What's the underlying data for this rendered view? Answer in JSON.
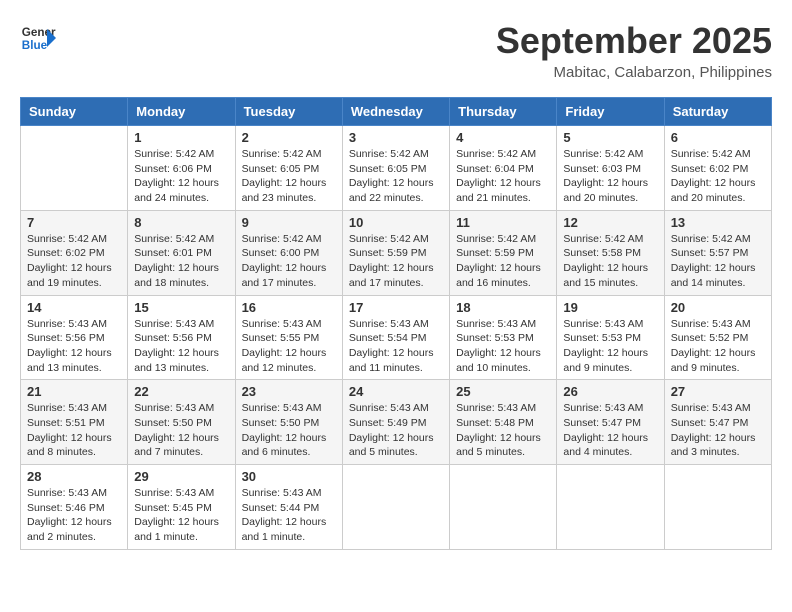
{
  "header": {
    "logo_line1": "General",
    "logo_line2": "Blue",
    "month": "September 2025",
    "location": "Mabitac, Calabarzon, Philippines"
  },
  "days_of_week": [
    "Sunday",
    "Monday",
    "Tuesday",
    "Wednesday",
    "Thursday",
    "Friday",
    "Saturday"
  ],
  "weeks": [
    [
      {
        "day": "",
        "info": ""
      },
      {
        "day": "1",
        "info": "Sunrise: 5:42 AM\nSunset: 6:06 PM\nDaylight: 12 hours\nand 24 minutes."
      },
      {
        "day": "2",
        "info": "Sunrise: 5:42 AM\nSunset: 6:05 PM\nDaylight: 12 hours\nand 23 minutes."
      },
      {
        "day": "3",
        "info": "Sunrise: 5:42 AM\nSunset: 6:05 PM\nDaylight: 12 hours\nand 22 minutes."
      },
      {
        "day": "4",
        "info": "Sunrise: 5:42 AM\nSunset: 6:04 PM\nDaylight: 12 hours\nand 21 minutes."
      },
      {
        "day": "5",
        "info": "Sunrise: 5:42 AM\nSunset: 6:03 PM\nDaylight: 12 hours\nand 20 minutes."
      },
      {
        "day": "6",
        "info": "Sunrise: 5:42 AM\nSunset: 6:02 PM\nDaylight: 12 hours\nand 20 minutes."
      }
    ],
    [
      {
        "day": "7",
        "info": "Sunrise: 5:42 AM\nSunset: 6:02 PM\nDaylight: 12 hours\nand 19 minutes."
      },
      {
        "day": "8",
        "info": "Sunrise: 5:42 AM\nSunset: 6:01 PM\nDaylight: 12 hours\nand 18 minutes."
      },
      {
        "day": "9",
        "info": "Sunrise: 5:42 AM\nSunset: 6:00 PM\nDaylight: 12 hours\nand 17 minutes."
      },
      {
        "day": "10",
        "info": "Sunrise: 5:42 AM\nSunset: 5:59 PM\nDaylight: 12 hours\nand 17 minutes."
      },
      {
        "day": "11",
        "info": "Sunrise: 5:42 AM\nSunset: 5:59 PM\nDaylight: 12 hours\nand 16 minutes."
      },
      {
        "day": "12",
        "info": "Sunrise: 5:42 AM\nSunset: 5:58 PM\nDaylight: 12 hours\nand 15 minutes."
      },
      {
        "day": "13",
        "info": "Sunrise: 5:42 AM\nSunset: 5:57 PM\nDaylight: 12 hours\nand 14 minutes."
      }
    ],
    [
      {
        "day": "14",
        "info": "Sunrise: 5:43 AM\nSunset: 5:56 PM\nDaylight: 12 hours\nand 13 minutes."
      },
      {
        "day": "15",
        "info": "Sunrise: 5:43 AM\nSunset: 5:56 PM\nDaylight: 12 hours\nand 13 minutes."
      },
      {
        "day": "16",
        "info": "Sunrise: 5:43 AM\nSunset: 5:55 PM\nDaylight: 12 hours\nand 12 minutes."
      },
      {
        "day": "17",
        "info": "Sunrise: 5:43 AM\nSunset: 5:54 PM\nDaylight: 12 hours\nand 11 minutes."
      },
      {
        "day": "18",
        "info": "Sunrise: 5:43 AM\nSunset: 5:53 PM\nDaylight: 12 hours\nand 10 minutes."
      },
      {
        "day": "19",
        "info": "Sunrise: 5:43 AM\nSunset: 5:53 PM\nDaylight: 12 hours\nand 9 minutes."
      },
      {
        "day": "20",
        "info": "Sunrise: 5:43 AM\nSunset: 5:52 PM\nDaylight: 12 hours\nand 9 minutes."
      }
    ],
    [
      {
        "day": "21",
        "info": "Sunrise: 5:43 AM\nSunset: 5:51 PM\nDaylight: 12 hours\nand 8 minutes."
      },
      {
        "day": "22",
        "info": "Sunrise: 5:43 AM\nSunset: 5:50 PM\nDaylight: 12 hours\nand 7 minutes."
      },
      {
        "day": "23",
        "info": "Sunrise: 5:43 AM\nSunset: 5:50 PM\nDaylight: 12 hours\nand 6 minutes."
      },
      {
        "day": "24",
        "info": "Sunrise: 5:43 AM\nSunset: 5:49 PM\nDaylight: 12 hours\nand 5 minutes."
      },
      {
        "day": "25",
        "info": "Sunrise: 5:43 AM\nSunset: 5:48 PM\nDaylight: 12 hours\nand 5 minutes."
      },
      {
        "day": "26",
        "info": "Sunrise: 5:43 AM\nSunset: 5:47 PM\nDaylight: 12 hours\nand 4 minutes."
      },
      {
        "day": "27",
        "info": "Sunrise: 5:43 AM\nSunset: 5:47 PM\nDaylight: 12 hours\nand 3 minutes."
      }
    ],
    [
      {
        "day": "28",
        "info": "Sunrise: 5:43 AM\nSunset: 5:46 PM\nDaylight: 12 hours\nand 2 minutes."
      },
      {
        "day": "29",
        "info": "Sunrise: 5:43 AM\nSunset: 5:45 PM\nDaylight: 12 hours\nand 1 minute."
      },
      {
        "day": "30",
        "info": "Sunrise: 5:43 AM\nSunset: 5:44 PM\nDaylight: 12 hours\nand 1 minute."
      },
      {
        "day": "",
        "info": ""
      },
      {
        "day": "",
        "info": ""
      },
      {
        "day": "",
        "info": ""
      },
      {
        "day": "",
        "info": ""
      }
    ]
  ]
}
